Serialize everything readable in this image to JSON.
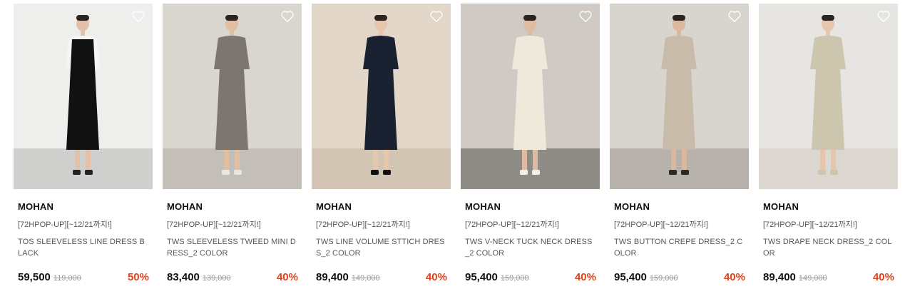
{
  "products": [
    {
      "brand": "MOHAN",
      "tag": "[72HPOP-UP][~12/21까지!]",
      "name": "TOS SLEEVELESS LINE DRESS BLACK",
      "price": "59,500",
      "original_price": "119,000",
      "discount": "50%",
      "colors": {
        "wall": "#eeeeec",
        "floor": "#cfcfcd",
        "dress": "#111111",
        "top": "#f4f4f2",
        "skin": "#e3c1a8",
        "shoes": "#222222"
      }
    },
    {
      "brand": "MOHAN",
      "tag": "[72HPOP-UP][~12/21까지!]",
      "name": "TWS SLEEVELESS TWEED MINI DRESS_2 COLOR",
      "price": "83,400",
      "original_price": "139,000",
      "discount": "40%",
      "colors": {
        "wall": "#d9d6d0",
        "floor": "#c3bfb8",
        "dress": "#7d7670",
        "top": "#7d7670",
        "skin": "#e2bea2",
        "shoes": "#e6e6e6"
      }
    },
    {
      "brand": "MOHAN",
      "tag": "[72HPOP-UP][~12/21까지!]",
      "name": "TWS LINE VOLUME STTICH DRESS_2 COLOR",
      "price": "89,400",
      "original_price": "149,000",
      "discount": "40%",
      "colors": {
        "wall": "#e2d7c9",
        "floor": "#d2c5b4",
        "dress": "#1a2130",
        "top": "#1a2130",
        "skin": "#e6c6ad",
        "shoes": "#111111"
      }
    },
    {
      "brand": "MOHAN",
      "tag": "[72HPOP-UP][~12/21까지!]",
      "name": "TWS V-NECK TUCK NECK DRESS_2 COLOR",
      "price": "95,400",
      "original_price": "159,000",
      "discount": "40%",
      "colors": {
        "wall": "#cfcbc4",
        "floor": "#8f8b86",
        "dress": "#efe9dc",
        "top": "#efe9dc",
        "skin": "#e0bba0",
        "shoes": "#f2efe8"
      }
    },
    {
      "brand": "MOHAN",
      "tag": "[72HPOP-UP][~12/21까지!]",
      "name": "TWS BUTTON CREPE DRESS_2 COLOR",
      "price": "95,400",
      "original_price": "159,000",
      "discount": "40%",
      "colors": {
        "wall": "#d8d5cf",
        "floor": "#b6b1aa",
        "dress": "#c9bba9",
        "top": "#c9bba9",
        "skin": "#dcb79c",
        "shoes": "#2a2a2a"
      }
    },
    {
      "brand": "MOHAN",
      "tag": "[72HPOP-UP][~12/21까지!]",
      "name": "TWS DRAPE NECK DRESS_2 COLOR",
      "price": "89,400",
      "original_price": "149,000",
      "discount": "40%",
      "colors": {
        "wall": "#e7e5e1",
        "floor": "#dcd8d1",
        "dress": "#cdc6ae",
        "top": "#cdc6ae",
        "skin": "#e6c5ac",
        "shoes": "#cdc6ae"
      }
    }
  ]
}
